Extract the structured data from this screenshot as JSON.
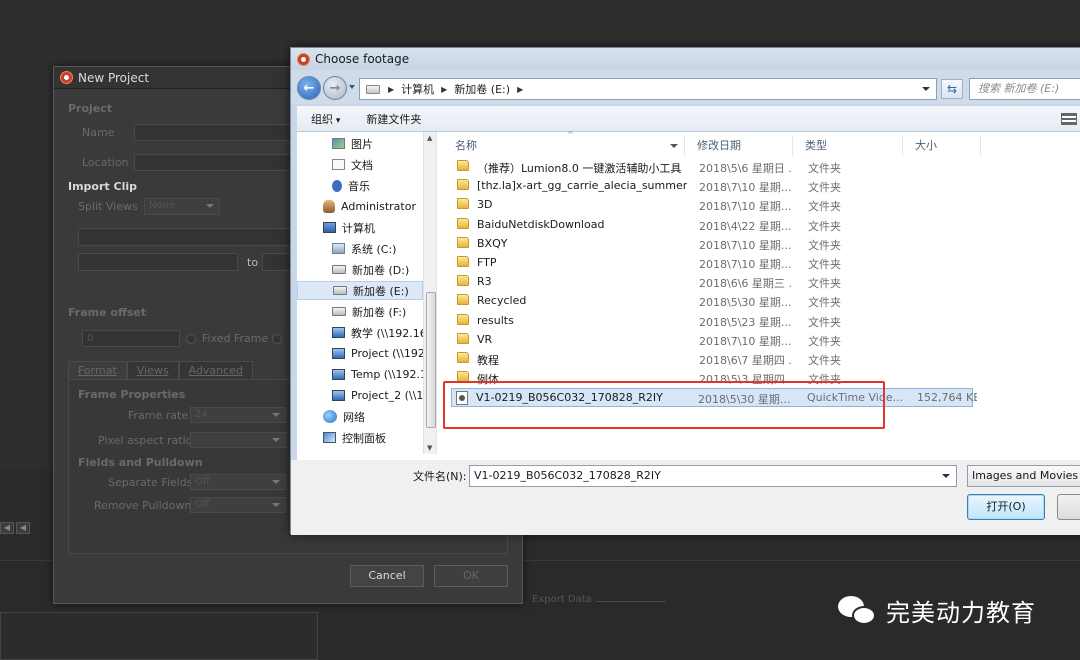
{
  "background": {
    "export_label": "Export Data"
  },
  "new_project": {
    "title": "New Project",
    "project_section": "Project",
    "name_label": "Name",
    "location_label": "Location",
    "import_clip_section": "Import Clip",
    "split_views_label": "Split Views",
    "split_views_value": "None",
    "to_label": "to",
    "frame_offset_section": "Frame offset",
    "frame_offset_value": "0",
    "fixed_frame_label": "Fixed Frame",
    "tabs": [
      "Format",
      "Views",
      "Advanced"
    ],
    "frame_properties_section": "Frame Properties",
    "frame_rate_label": "Frame rate",
    "frame_rate_value": "24",
    "pixel_aspect_label": "Pixel aspect ratio",
    "fields_section": "Fields and Pulldown",
    "separate_fields_label": "Separate Fields",
    "separate_fields_value": "Off",
    "remove_pulldown_label": "Remove Pulldown",
    "remove_pulldown_value": "Off",
    "cancel_label": "Cancel",
    "ok_label": "OK"
  },
  "choose_footage": {
    "title": "Choose footage",
    "breadcrumbs": [
      "计算机",
      "新加卷 (E:)"
    ],
    "search_placeholder": "搜索 新加卷 (E:)",
    "toolbar": {
      "organize_label": "组织",
      "new_folder_label": "新建文件夹"
    },
    "tree": [
      {
        "label": "图片",
        "icon": "pictures-icon"
      },
      {
        "label": "文档",
        "icon": "documents-icon"
      },
      {
        "label": "音乐",
        "icon": "music-icon"
      },
      {
        "label": "Administrator",
        "icon": "user-folder-icon"
      },
      {
        "label": "计算机",
        "icon": "computer-icon"
      },
      {
        "label": "系统 (C:)",
        "icon": "system-drive-icon"
      },
      {
        "label": "新加卷 (D:)",
        "icon": "drive-icon"
      },
      {
        "label": "新加卷 (E:)",
        "icon": "drive-icon"
      },
      {
        "label": "新加卷 (F:)",
        "icon": "drive-icon"
      },
      {
        "label": "教学 (\\\\192.16",
        "icon": "network-drive-icon"
      },
      {
        "label": "Project (\\\\192",
        "icon": "network-drive-icon"
      },
      {
        "label": "Temp (\\\\192.1",
        "icon": "network-drive-icon"
      },
      {
        "label": "Project_2 (\\\\1",
        "icon": "network-drive-icon"
      },
      {
        "label": "网络",
        "icon": "network-icon"
      },
      {
        "label": "控制面板",
        "icon": "control-panel-icon"
      }
    ],
    "columns": [
      "名称",
      "修改日期",
      "类型",
      "大小"
    ],
    "files": [
      {
        "name": "（推荐）Lumion8.0 一键激活辅助小工具",
        "date": "2018\\5\\6 星期日 ...",
        "type": "文件夹",
        "size": ""
      },
      {
        "name": "[thz.la]x-art_gg_carrie_alecia_summer...",
        "date": "2018\\7\\10 星期...",
        "type": "文件夹",
        "size": ""
      },
      {
        "name": "3D",
        "date": "2018\\7\\10 星期...",
        "type": "文件夹",
        "size": ""
      },
      {
        "name": "BaiduNetdiskDownload",
        "date": "2018\\4\\22 星期...",
        "type": "文件夹",
        "size": ""
      },
      {
        "name": "BXQY",
        "date": "2018\\7\\10 星期...",
        "type": "文件夹",
        "size": ""
      },
      {
        "name": "FTP",
        "date": "2018\\7\\10 星期...",
        "type": "文件夹",
        "size": ""
      },
      {
        "name": "R3",
        "date": "2018\\6\\6 星期三 ...",
        "type": "文件夹",
        "size": ""
      },
      {
        "name": "Recycled",
        "date": "2018\\5\\30 星期...",
        "type": "文件夹",
        "size": ""
      },
      {
        "name": "results",
        "date": "2018\\5\\23 星期...",
        "type": "文件夹",
        "size": ""
      },
      {
        "name": "VR",
        "date": "2018\\7\\10 星期...",
        "type": "文件夹",
        "size": ""
      },
      {
        "name": "教程",
        "date": "2018\\6\\7 星期四 ...",
        "type": "文件夹",
        "size": ""
      },
      {
        "name": "例体",
        "date": "2018\\5\\3 星期四 ...",
        "type": "文件夹",
        "size": ""
      },
      {
        "name": "V1-0219_B056C032_170828_R2IY",
        "date": "2018\\5\\30 星期...",
        "type": "QuickTime Vide...",
        "size": "152,764 KB"
      }
    ],
    "selected_index": 12,
    "filename_label": "文件名(N):",
    "filename_value": "V1-0219_B056C032_170828_R2IY",
    "filetype_value": "Images and Movies (",
    "open_label": "打开(O)"
  },
  "watermark": {
    "text": "完美动力教育"
  },
  "colors": {
    "annotation_red": "#e8312f",
    "selection_blue": "#d6e6f7"
  }
}
